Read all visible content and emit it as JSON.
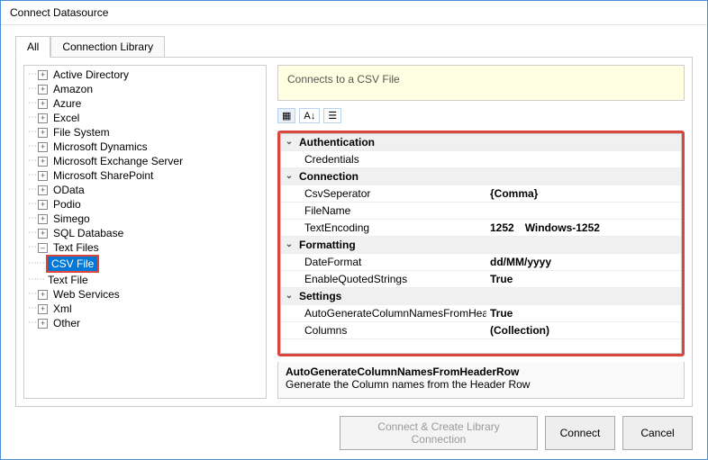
{
  "window": {
    "title": "Connect Datasource"
  },
  "tabs": {
    "all": "All",
    "lib": "Connection Library"
  },
  "tree": {
    "root": [
      "Active Directory",
      "Amazon",
      "Azure",
      "Excel",
      "File System",
      "Microsoft Dynamics",
      "Microsoft Exchange Server",
      "Microsoft SharePoint",
      "OData",
      "Podio",
      "Simego",
      "SQL Database"
    ],
    "textfiles": {
      "label": "Text Files",
      "csv": "CSV File",
      "txt": "Text File"
    },
    "tail": [
      "Web Services",
      "Xml",
      "Other"
    ]
  },
  "description": "Connects to a CSV File",
  "props": {
    "cats": {
      "auth": "Authentication",
      "conn": "Connection",
      "fmt": "Formatting",
      "set": "Settings"
    },
    "auth": {
      "credentials_k": "Credentials",
      "credentials_v": ""
    },
    "conn": {
      "sep_k": "CsvSeperator",
      "sep_v": "{Comma}",
      "file_k": "FileName",
      "file_v": "",
      "enc_k": "TextEncoding",
      "enc_v": "1252 Windows-1252"
    },
    "fmt": {
      "date_k": "DateFormat",
      "date_v": "dd/MM/yyyy",
      "quote_k": "EnableQuotedStrings",
      "quote_v": "True"
    },
    "set": {
      "auto_k": "AutoGenerateColumnNamesFromHeaderRow",
      "auto_v": "True",
      "cols_k": "Columns",
      "cols_v": "(Collection)"
    }
  },
  "help": {
    "title": "AutoGenerateColumnNamesFromHeaderRow",
    "text": "Generate the Column names from the Header Row"
  },
  "buttons": {
    "createlib": "Connect & Create Library Connection",
    "connect": "Connect",
    "cancel": "Cancel"
  }
}
